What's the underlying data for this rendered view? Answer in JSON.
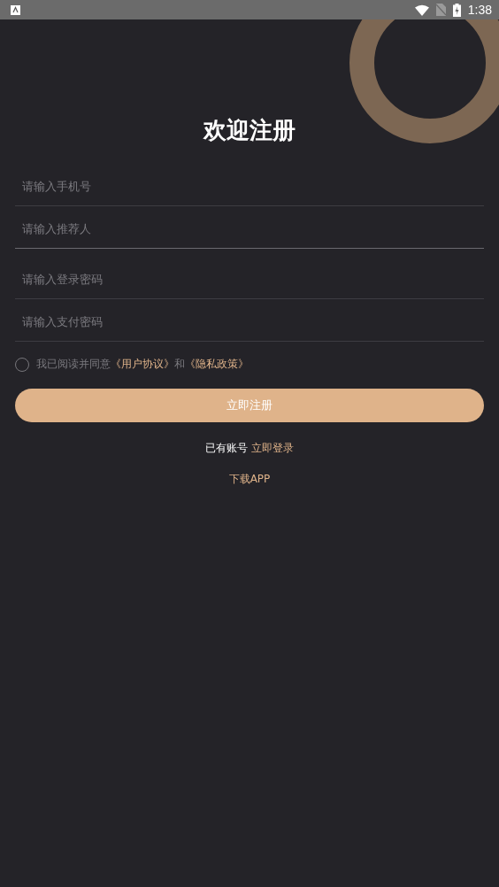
{
  "status_bar": {
    "time": "1:38"
  },
  "title": "欢迎注册",
  "fields": [
    {
      "placeholder": "请输入手机号",
      "focused": false
    },
    {
      "placeholder": "请输入推荐人",
      "focused": true
    },
    {
      "placeholder": "请输入登录密码",
      "focused": false
    },
    {
      "placeholder": "请输入支付密码",
      "focused": false
    }
  ],
  "agreement": {
    "checked": false,
    "text": "我已阅读并同意",
    "link_1": "《用户协议》",
    "joiner": "和",
    "link_2": "《隐私政策》"
  },
  "register_button": "立即注册",
  "login_prompt": {
    "text": "已有账号",
    "link": "立即登录"
  },
  "download_link": "下载APP"
}
